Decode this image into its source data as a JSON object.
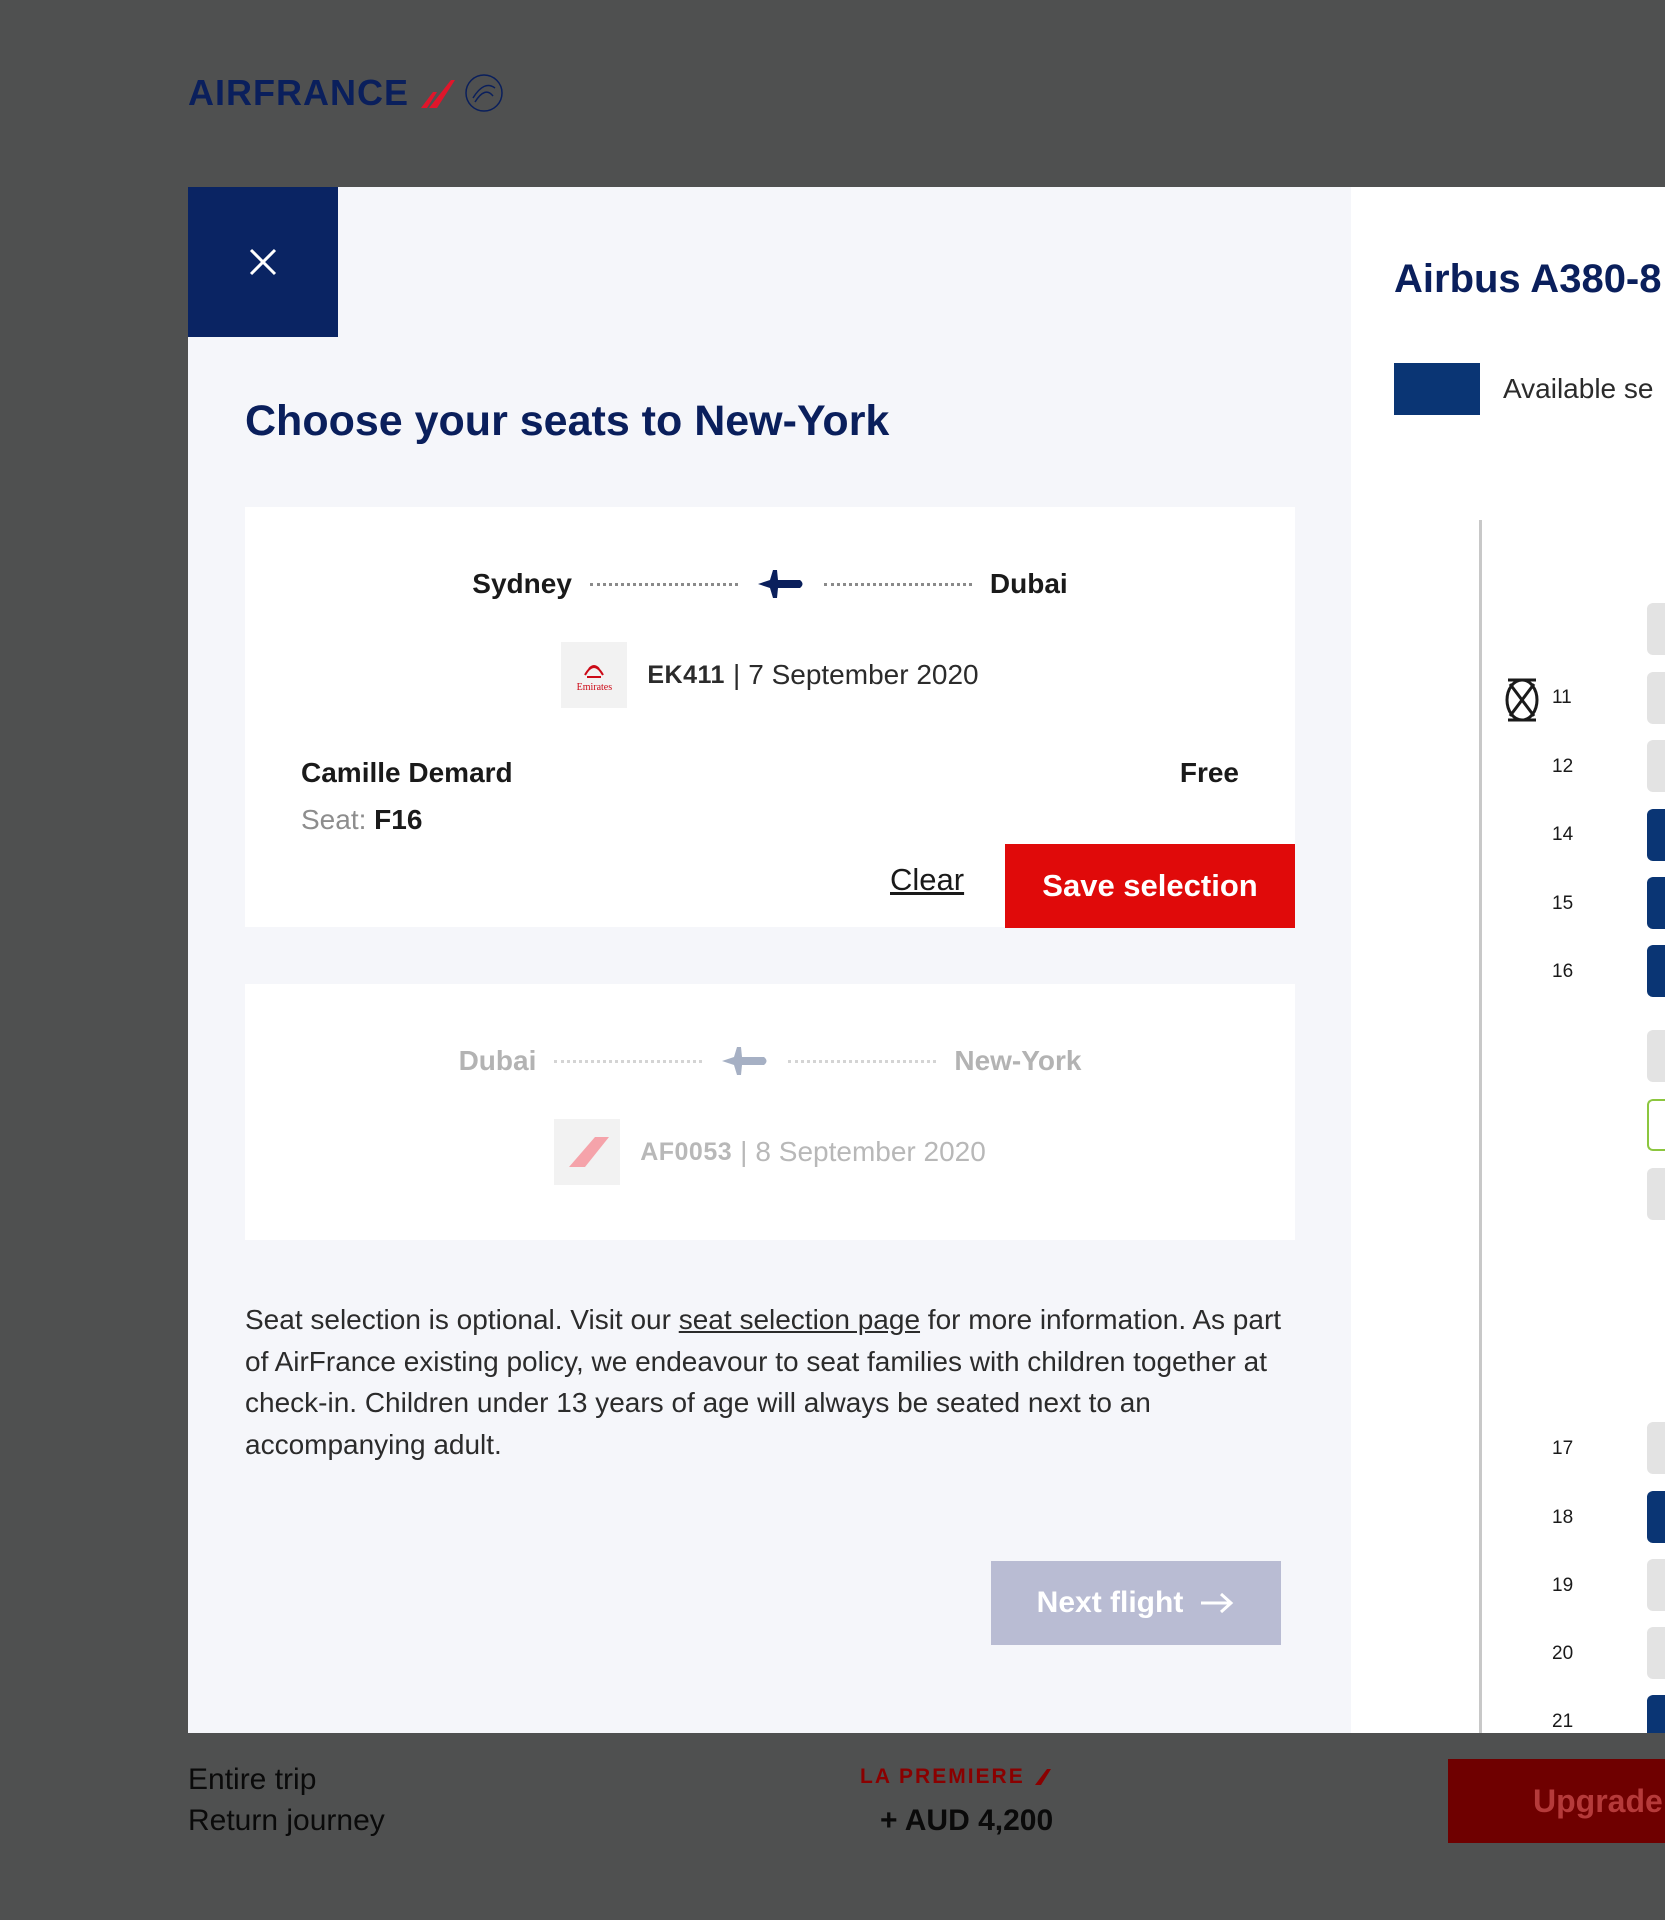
{
  "brand": {
    "name": "AIRFRANCE"
  },
  "modal": {
    "close_icon": "close-icon",
    "title": "Choose your seats to New-York",
    "flight1": {
      "origin": "Sydney",
      "destination": "Dubai",
      "airline_logo_text": "Emirates",
      "flight_number": "EK411",
      "date": "7 September 2020",
      "passenger_name": "Camille Demard",
      "seat_label": "Seat:",
      "seat_value": "F16",
      "price": "Free",
      "clear_label": "Clear",
      "save_label": "Save selection"
    },
    "flight2": {
      "origin": "Dubai",
      "destination": "New-York",
      "flight_number": "AF0053",
      "date": "8 September 2020"
    },
    "info": {
      "part1": "Seat selection is optional. Visit our ",
      "link": "seat selection page",
      "part2": " for more information. As part of AirFrance existing policy, we endeavour to seat families with children together at check-in. Children under 13 years of age will always be seated next to an accompanying adult."
    },
    "next_label": "Next flight"
  },
  "seatmap": {
    "aircraft": "Airbus A380-8",
    "legend_label": "Available se",
    "rows": [
      "11",
      "12",
      "14",
      "15",
      "16",
      "17",
      "18",
      "19",
      "20",
      "21"
    ]
  },
  "footer": {
    "trip_label": "Entire trip",
    "journey_label": "Return journey",
    "cabin_label": "LA PREMIERE",
    "price": "+ AUD 4,200",
    "upgrade_label": "Upgrade"
  },
  "colors": {
    "navy": "#0a1f5c",
    "close_bg": "#0a2463",
    "save_red": "#e00a0a",
    "next_disabled": "#b9bcd3",
    "available_seat": "#0a3574"
  }
}
